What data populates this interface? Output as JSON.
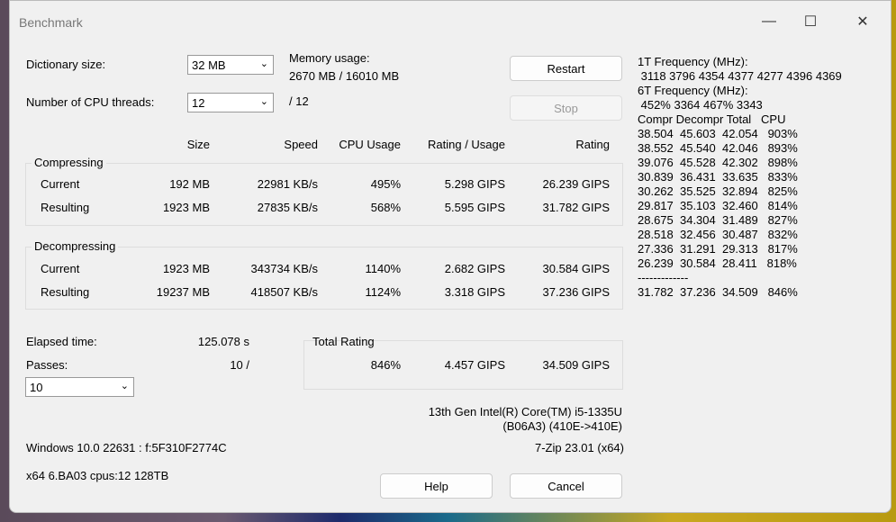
{
  "window": {
    "title": "Benchmark",
    "minimize": "—",
    "maximize": "☐",
    "close": "✕"
  },
  "settings": {
    "dict_label": "Dictionary size:",
    "dict_value": "32 MB",
    "threads_label": "Number of CPU threads:",
    "threads_value": "12",
    "threads_max": "/ 12",
    "memory_label": "Memory usage:",
    "memory_value": "2670 MB / 16010 MB"
  },
  "buttons": {
    "restart": "Restart",
    "stop": "Stop",
    "help": "Help",
    "cancel": "Cancel"
  },
  "columns": [
    "Size",
    "Speed",
    "CPU Usage",
    "Rating / Usage",
    "Rating"
  ],
  "compressing": {
    "label": "Compressing",
    "rows": [
      {
        "name": "Current",
        "cells": [
          "192 MB",
          "22981 KB/s",
          "495%",
          "5.298 GIPS",
          "26.239 GIPS"
        ]
      },
      {
        "name": "Resulting",
        "cells": [
          "1923 MB",
          "27835 KB/s",
          "568%",
          "5.595 GIPS",
          "31.782 GIPS"
        ]
      }
    ]
  },
  "decompressing": {
    "label": "Decompressing",
    "rows": [
      {
        "name": "Current",
        "cells": [
          "1923 MB",
          "343734 KB/s",
          "1140%",
          "2.682 GIPS",
          "30.584 GIPS"
        ]
      },
      {
        "name": "Resulting",
        "cells": [
          "19237 MB",
          "418507 KB/s",
          "1124%",
          "3.318 GIPS",
          "37.236 GIPS"
        ]
      }
    ]
  },
  "elapsed": {
    "label": "Elapsed time:",
    "value": "125.078 s"
  },
  "passes": {
    "label": "Passes:",
    "value": "10 /",
    "select": "10"
  },
  "total": {
    "label": "Total Rating",
    "cpu": "846%",
    "rating_usage": "4.457 GIPS",
    "rating": "34.509 GIPS"
  },
  "cpu_info": {
    "line1": "13th Gen Intel(R) Core(TM) i5-1335U",
    "line2": "(B06A3) (410E->410E)"
  },
  "sys": {
    "os": "Windows 10.0 22631 : f:5F310F2774C",
    "version": "7-Zip 23.01 (x64)",
    "arch": "x64 6.BA03 cpus:12 128TB"
  },
  "log": "1T Frequency (MHz):\n 3118 3796 4354 4377 4277 4396 4369\n6T Frequency (MHz):\n 452% 3364 467% 3343\nCompr Decompr Total   CPU\n38.504  45.603  42.054   903%\n38.552  45.540  42.046   893%\n39.076  45.528  42.302   898%\n30.839  36.431  33.635   833%\n30.262  35.525  32.894   825%\n29.817  35.103  32.460   814%\n28.675  34.304  31.489   827%\n28.518  32.456  30.487   832%\n27.336  31.291  29.313   817%\n26.239  30.584  28.411   818%\n-------------\n31.782  37.236  34.509   846%"
}
